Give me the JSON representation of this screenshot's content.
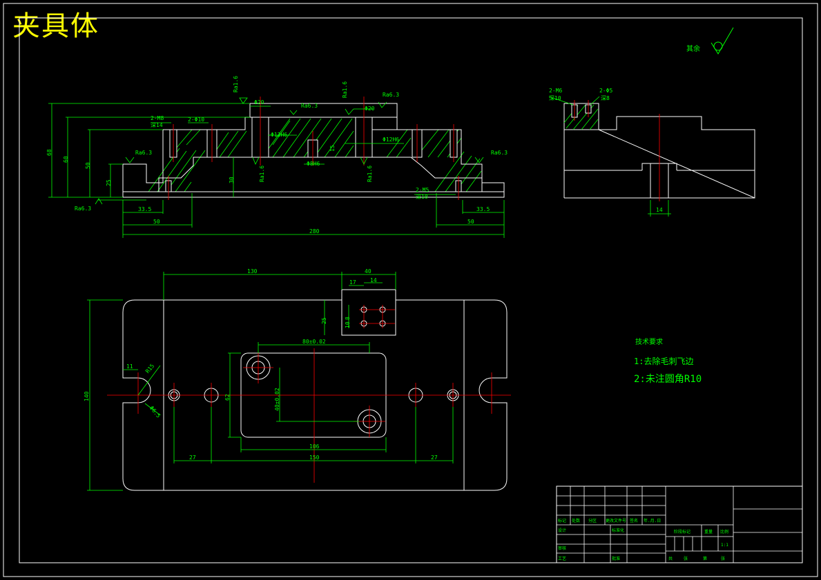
{
  "title": "夹具体",
  "surface_symbol_label": "其余",
  "colors": {
    "background": "#000000",
    "outline": "#ffffff",
    "dimension": "#00ff00",
    "centerline": "#ff0000",
    "title": "#ffff00"
  },
  "front_view": {
    "roughness": [
      "Ra1.6",
      "Ra6.3",
      "Ra1.6",
      "Ra6.3",
      "Ra6.3",
      "Ra6.3",
      "Ra1.6",
      "Ra1.6",
      "Ra6.3"
    ],
    "dims": {
      "d20_left": "Φ20",
      "d20_right": "Φ20",
      "d10": "2-Φ10",
      "m8": "2-M8",
      "m8_depth": "深14",
      "m5": "2-M5",
      "m5_depth": "深10",
      "d12h6": "Φ12H6",
      "d12h6_b": "Φ12H6",
      "d8h6": "Φ8H6",
      "h68": "68",
      "h60": "60",
      "h50": "50",
      "h25": "25",
      "h30": "30",
      "h15": "15",
      "w33_5_left": "33.5",
      "w50_left": "50",
      "w33_5_right": "33.5",
      "w50_right": "50",
      "w280": "280"
    }
  },
  "side_view": {
    "m6": "2-M6",
    "m6_depth": "深10",
    "d5": "2-Φ5",
    "d5_depth": "深8",
    "w14": "14"
  },
  "top_view": {
    "dims": {
      "w130": "130",
      "w40": "40",
      "w17": "17",
      "w14": "14",
      "h8": "8",
      "h10": "10",
      "h25": "25",
      "w80": "80±0.02",
      "h40": "40±0.02",
      "h62": "62",
      "h140": "140",
      "r15": "R15",
      "d6_5": "Φ6.5",
      "w11": "11",
      "w27_left": "27",
      "w106": "106",
      "w150": "150",
      "w27_right": "27"
    }
  },
  "tech_req": {
    "heading": "技术要求",
    "items": [
      "1:去除毛刺飞边",
      "2:未注圆角R10"
    ]
  },
  "title_block": {
    "row_labels": [
      "标记",
      "处数",
      "分区",
      "更改文件号",
      "签名",
      "年.月.日"
    ],
    "design": "设计",
    "standardize": "标准化",
    "review": "审核",
    "process": "工艺",
    "approve": "批准",
    "stage_mark": "阶段标记",
    "weight": "重量",
    "scale_label": "比例",
    "scale": "1:1",
    "sheets_total": "共",
    "sheet_unit": "张",
    "sheet_no": "第",
    "sheet_unit2": "张"
  }
}
